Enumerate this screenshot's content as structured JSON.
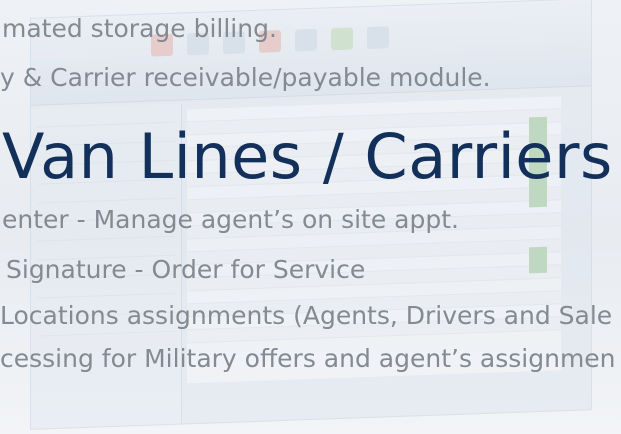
{
  "overlay": {
    "line_1": "mated storage billing.",
    "line_2": "y & Carrier receivable/payable module.",
    "headline": "Van Lines / Carriers",
    "line_4": "enter - Manage agent’s on site appt.",
    "line_5": "Signature - Order for Service",
    "line_6": "Locations assignments (Agents, Drivers and Sale",
    "line_7": "cessing for Military offers and agent’s assignmen"
  },
  "colors": {
    "headline": "#12305a",
    "bullet_text": "#838a92",
    "background": "#eef1f5"
  }
}
